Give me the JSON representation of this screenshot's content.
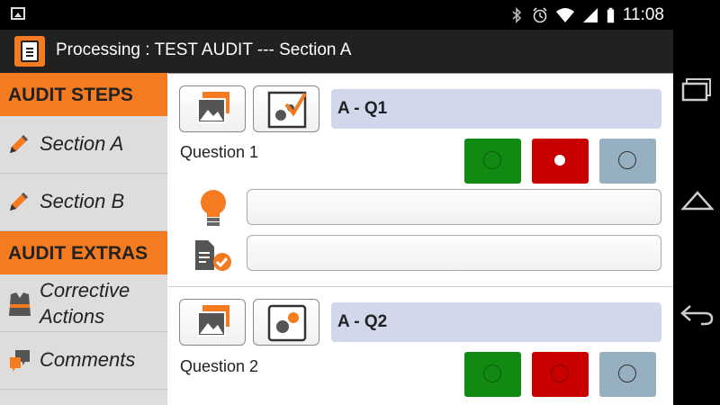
{
  "status_bar": {
    "time": "11:08",
    "icons": [
      "image-icon",
      "bluetooth-icon",
      "alarm-icon",
      "wifi-icon",
      "signal-icon",
      "battery-icon"
    ]
  },
  "action_bar": {
    "title": "Processing : TEST AUDIT --- Section A",
    "logo": "audit-clipboard-icon"
  },
  "sidebar": {
    "steps_header": "AUDIT STEPS",
    "steps": [
      {
        "label": "Section A",
        "icon": "pencil-icon"
      },
      {
        "label": "Section B",
        "icon": "pencil-icon"
      }
    ],
    "extras_header": "AUDIT EXTRAS",
    "extras": [
      {
        "label_line1": "Corrective",
        "label_line2": "Actions",
        "icon": "safety-vest-icon"
      },
      {
        "label": "Comments",
        "icon": "comment-icon"
      }
    ]
  },
  "questions": [
    {
      "title": "A - Q1",
      "label": "Question 1",
      "selected": "red",
      "hint_placeholder": "",
      "action_placeholder": ""
    },
    {
      "title": "A - Q2",
      "label": "Question 2",
      "selected": "none"
    }
  ],
  "colors": {
    "accent": "#f47b20",
    "green": "#128a12",
    "red": "#c80000",
    "grey_blue": "#96afc1",
    "question_title_bg": "#d2d8ec"
  }
}
